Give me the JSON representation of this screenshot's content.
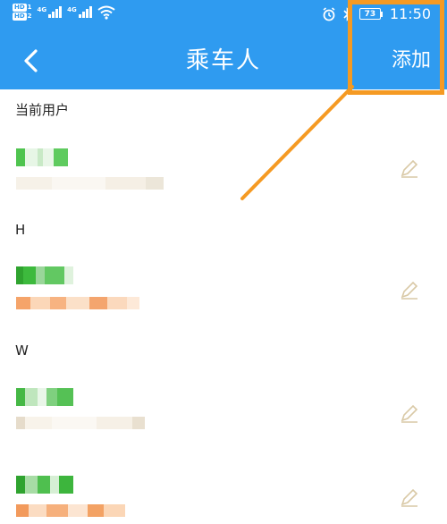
{
  "status_bar": {
    "sim1": {
      "badge": "HD",
      "num": "1"
    },
    "sim2": {
      "badge": "HD",
      "num": "2"
    },
    "net1": "4G",
    "net2": "4G",
    "battery": "73",
    "time": "11:50"
  },
  "app_bar": {
    "title": "乘车人",
    "add_label": "添加"
  },
  "sections": {
    "current_user": "当前用户",
    "h": "H",
    "w": "W"
  },
  "colors": {
    "header": "#2f9bf0",
    "highlight": "#f59a23",
    "edit_icon": "#d9c9a6"
  }
}
